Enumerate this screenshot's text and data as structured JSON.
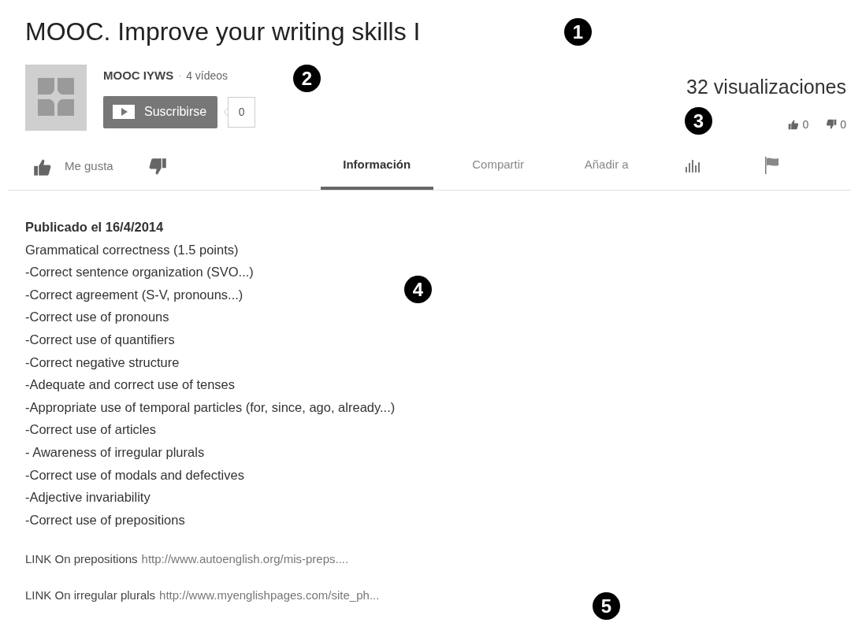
{
  "title": "MOOC. Improve your writing skills I",
  "channel": {
    "name": "MOOC IYWS",
    "separator": "·",
    "videos": "4 vídeos",
    "subscribe": "Suscribirse",
    "subscribers": "0"
  },
  "views": "32 visualizaciones",
  "ratings": {
    "likes": "0",
    "dislikes": "0"
  },
  "actions": {
    "like": "Me gusta"
  },
  "tabs": [
    {
      "kind": "text",
      "label": "Información",
      "selected": true
    },
    {
      "kind": "text",
      "label": "Compartir",
      "selected": false
    },
    {
      "kind": "text",
      "label": "Añadir a",
      "selected": false
    },
    {
      "kind": "stats",
      "selected": false
    },
    {
      "kind": "flag",
      "selected": false
    }
  ],
  "description": {
    "published": "Publicado el 16/4/2014",
    "lines": [
      "Grammatical correctness (1.5 points)",
      "-Correct sentence organization (SVO...)",
      "-Correct agreement (S-V, pronouns...)",
      "-Correct use of pronouns",
      "-Correct use of quantifiers",
      "-Correct negative structure",
      "-Adequate and correct use of tenses",
      "-Appropriate use of temporal particles (for, since, ago, already...)",
      "-Correct use of articles",
      "- Awareness of irregular plurals",
      "-Correct use of modals and defectives",
      "-Adjective invariability",
      "-Correct use of prepositions"
    ],
    "links": [
      {
        "label": "LINK On prepositions",
        "url": "http://www.autoenglish.org/mis-preps...."
      },
      {
        "label": "LINK On irregular plurals",
        "url": "http://www.myenglishpages.com/site_ph..."
      }
    ]
  },
  "callouts": [
    "1",
    "2",
    "3",
    "4",
    "5"
  ]
}
